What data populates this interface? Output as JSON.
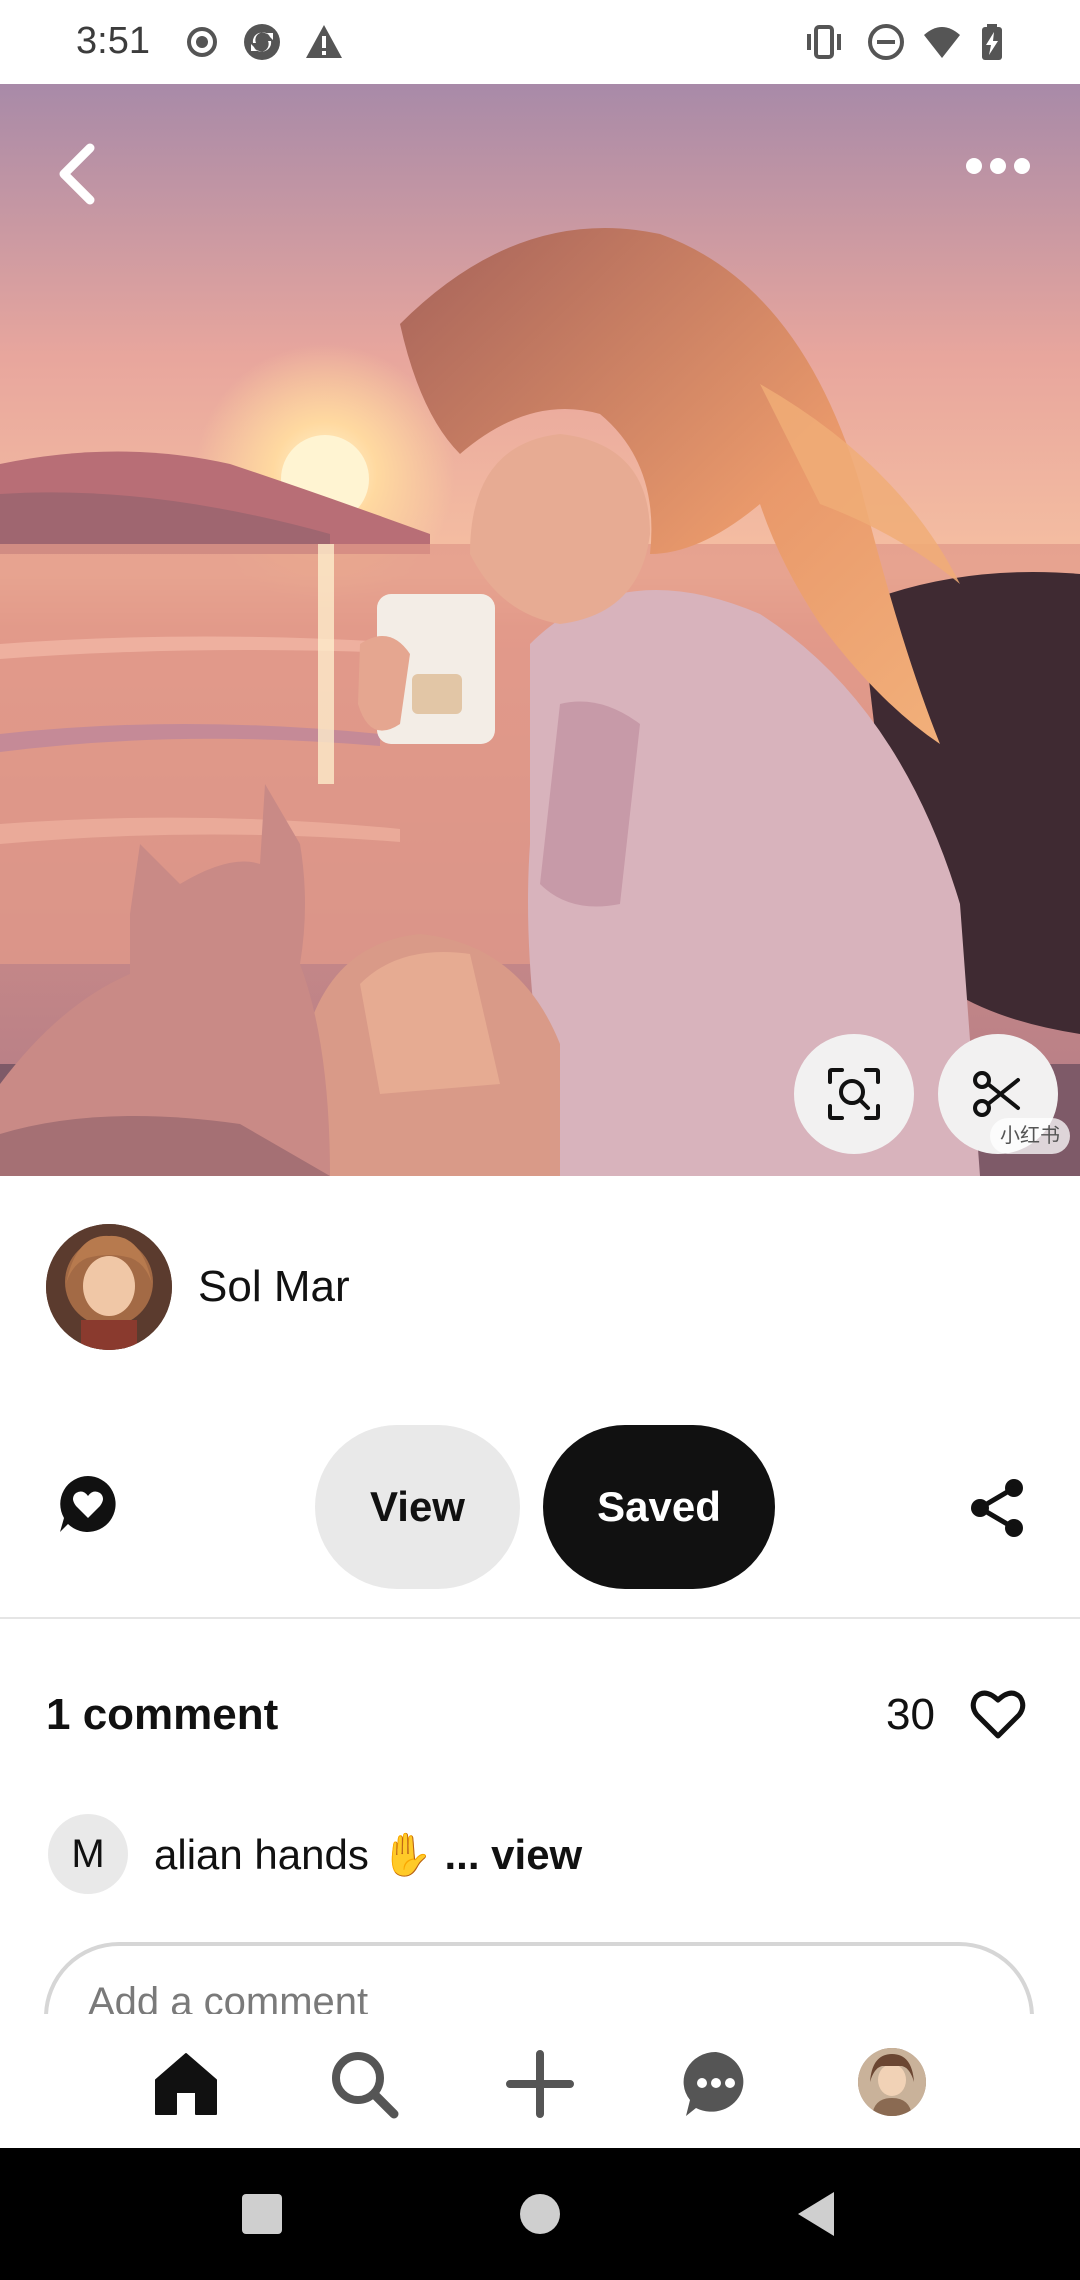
{
  "status_bar": {
    "time": "3:51",
    "left_icons": [
      "record-icon",
      "sync-icon",
      "warning-icon"
    ],
    "right_icons": [
      "vibrate-icon",
      "do-not-disturb-icon",
      "wifi-icon",
      "battery-charging-icon"
    ]
  },
  "hero": {
    "icons": [
      "back-icon",
      "more-icon",
      "visual-search-icon",
      "scissors-icon"
    ],
    "watermark": "小红书"
  },
  "author": {
    "name": "Sol Mar"
  },
  "actions": {
    "view_label": "View",
    "saved_label": "Saved"
  },
  "comments": {
    "count_label": "1 comment",
    "likes": "30",
    "first": {
      "avatar_initial": "M",
      "text": "alian hands",
      "emoji": "✋",
      "more": "... view"
    },
    "input_placeholder": "Add a comment"
  },
  "bottom_nav": {
    "items": [
      "home-icon",
      "search-icon",
      "create-icon",
      "messages-icon",
      "profile-avatar"
    ]
  },
  "colors": {
    "primary_button": "#111111",
    "secondary_button": "#e9e9e9",
    "heart": "#111111"
  }
}
